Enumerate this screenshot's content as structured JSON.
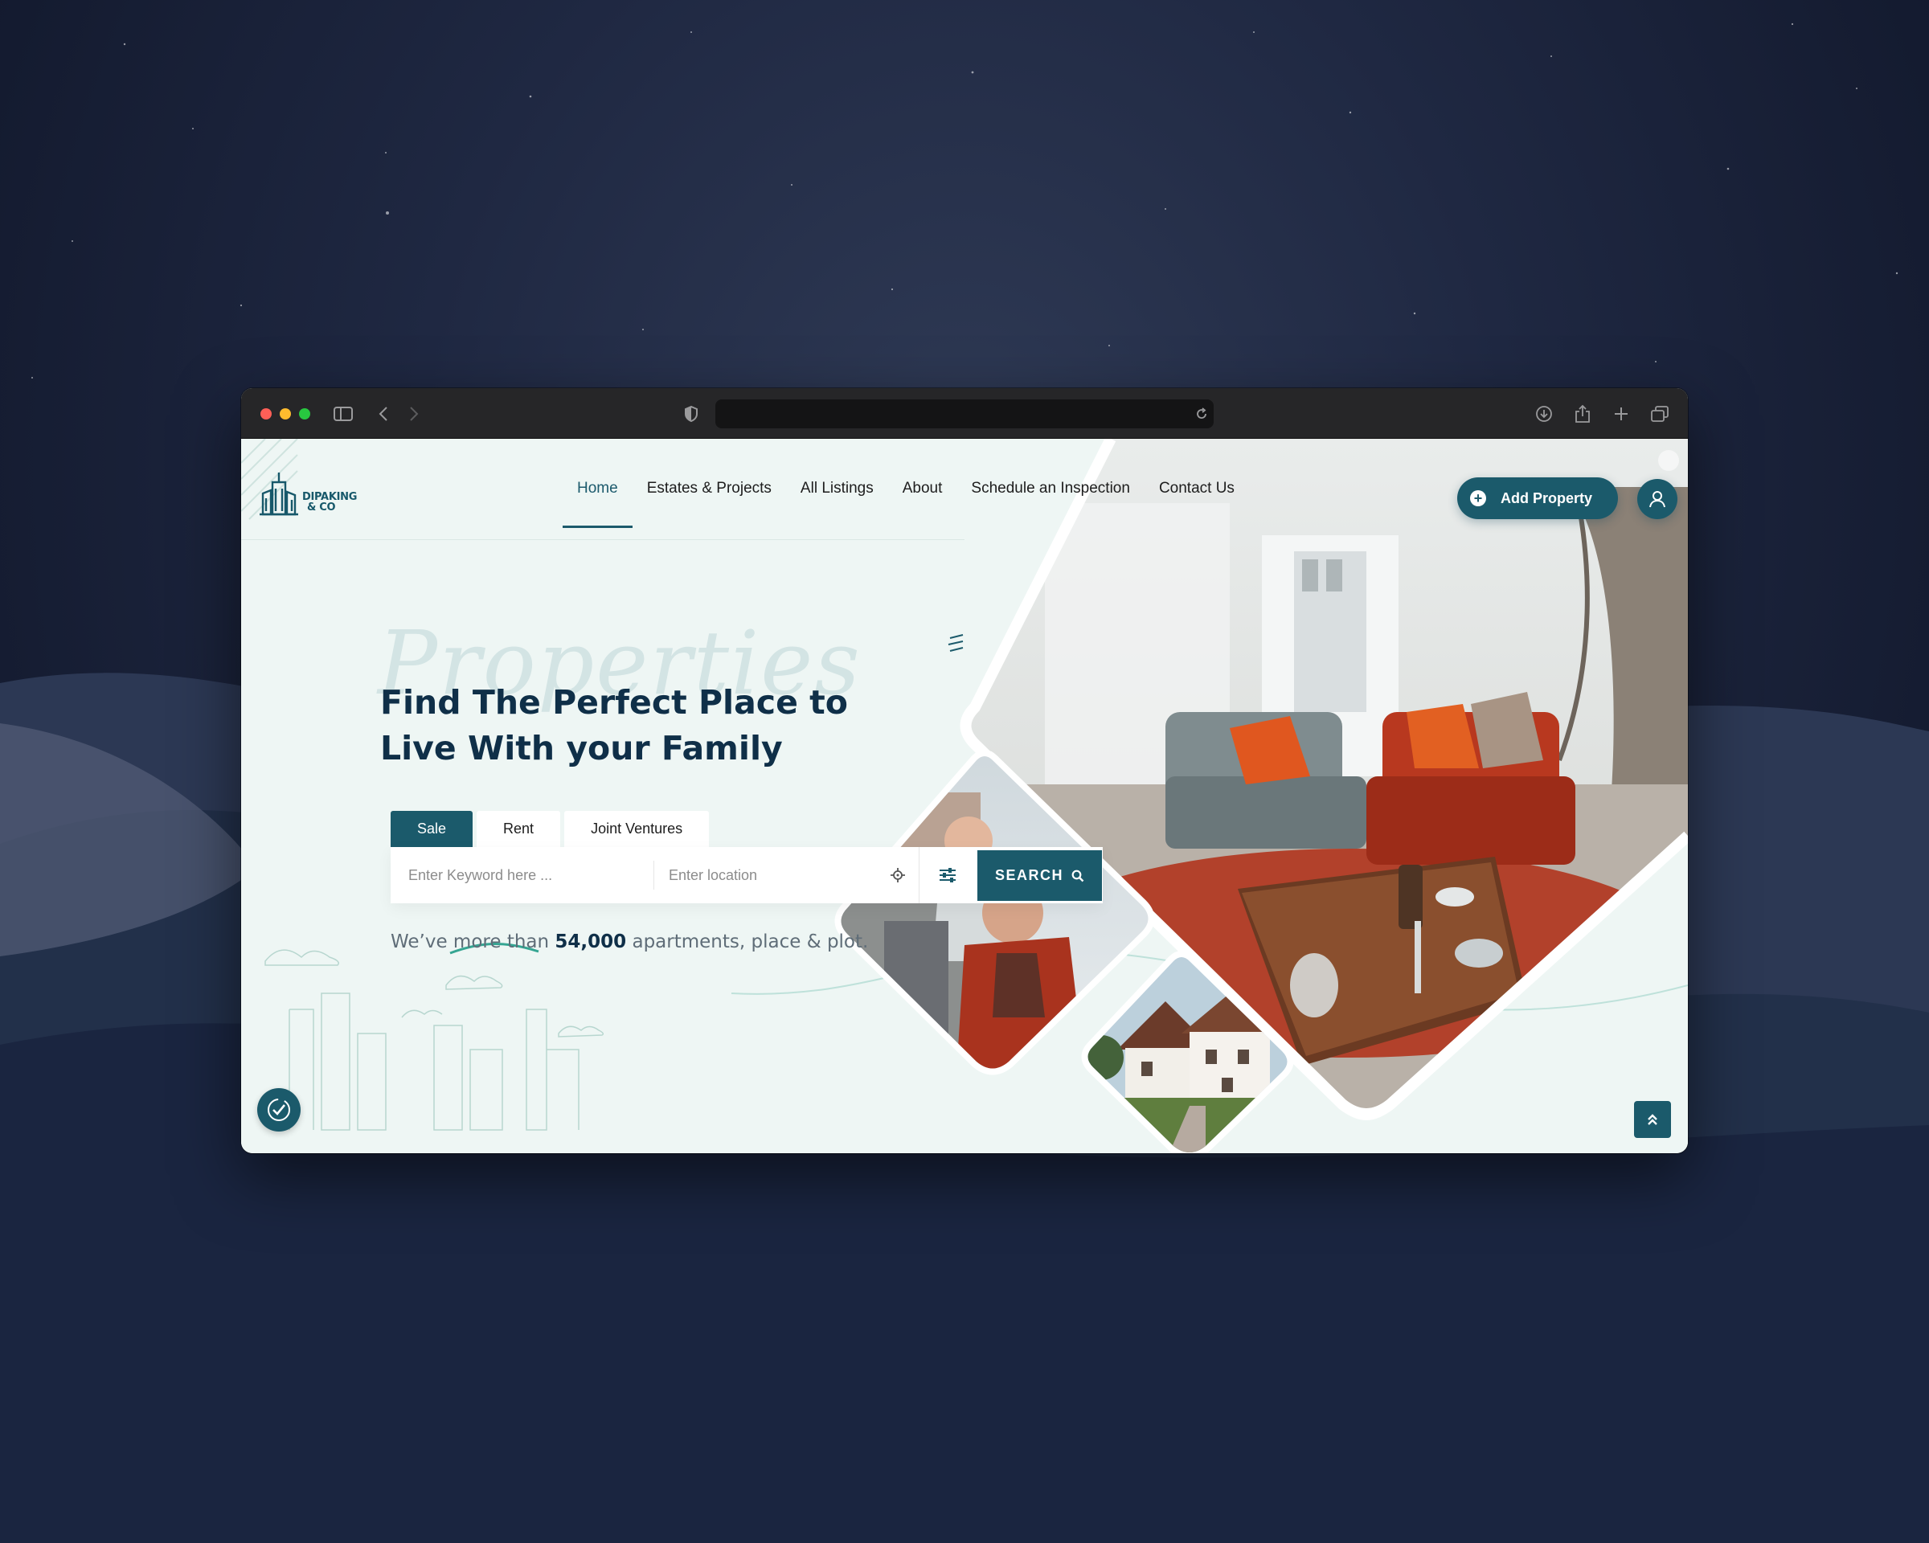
{
  "brand": {
    "name_line1": "DIPAKING",
    "name_line2": "& CO"
  },
  "nav": {
    "items": [
      {
        "label": "Home",
        "active": true
      },
      {
        "label": "Estates & Projects"
      },
      {
        "label": "All Listings"
      },
      {
        "label": "About"
      },
      {
        "label": "Schedule an Inspection"
      },
      {
        "label": "Contact Us"
      }
    ]
  },
  "header": {
    "add_property": "Add Property",
    "user_icon": "user-icon"
  },
  "hero": {
    "script_word": "Properties",
    "headline_line1": "Find The Perfect Place to",
    "headline_line2": "Live With your Family",
    "tabs": [
      {
        "label": "Sale",
        "active": true
      },
      {
        "label": "Rent"
      },
      {
        "label": "Joint Ventures"
      }
    ],
    "search": {
      "keyword_placeholder": "Enter Keyword here ...",
      "location_placeholder": "Enter location",
      "button_label": "SEARCH"
    },
    "stat_prefix": "We’ve more than ",
    "stat_number": "54,000",
    "stat_suffix": " apartments, place & plot."
  },
  "colors": {
    "accent": "#1b5a6b",
    "headline": "#0f2f48",
    "page_bg": "#eef6f4"
  }
}
